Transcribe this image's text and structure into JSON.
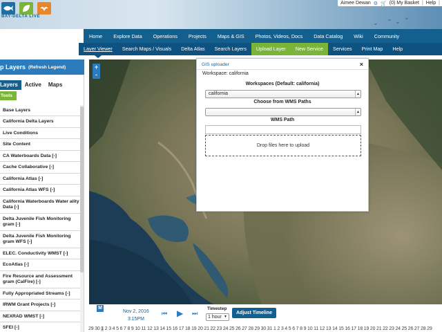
{
  "header": {
    "logo_text": "BAY-DELTA LIVE",
    "user_name": "Aimee Dewan",
    "basket": "(0) My Basket",
    "help": "Help"
  },
  "main_nav": [
    {
      "label": "Home"
    },
    {
      "label": "Explore Data"
    },
    {
      "label": "Operations"
    },
    {
      "label": "Projects"
    },
    {
      "label": "Maps & GIS"
    },
    {
      "label": "Photos, Videos, Docs"
    },
    {
      "label": "Data Catalog"
    },
    {
      "label": "Wiki"
    },
    {
      "label": "Community"
    }
  ],
  "sub_nav": [
    {
      "label": "Layer Viewer"
    },
    {
      "label": "Search Maps / Visuals"
    },
    {
      "label": "Delta Atlas"
    },
    {
      "label": "Search Layers"
    },
    {
      "label": "Upload Layer"
    },
    {
      "label": "New Service"
    },
    {
      "label": "Services"
    },
    {
      "label": "Print Map"
    },
    {
      "label": "Help"
    }
  ],
  "panel": {
    "title": "p Layers",
    "refresh": "(Refresh Legend)",
    "tabs": [
      "Layers",
      "Active",
      "Maps"
    ],
    "tools": "Tools",
    "layers": [
      "Base Layers",
      "California Delta Layers",
      "Live Conditions",
      "Site Content",
      "CA Waterboards Data [-]",
      "Cache Collaborative [-]",
      "California Atlas [-]",
      "California Atlas WFS [-]",
      "California Waterboards Water ality Data [-]",
      "Delta Juvenile Fish Monitoring gram [-]",
      "Delta Juvenile Fish Monitoring gram WFS [-]",
      "ELEC. Conductivity WMST [-]",
      "EcoAtlas [-]",
      "Fire Resource and Assessment gram (CalFire) [-]",
      "Fully Appropriated Streams [-]",
      "IRWM Grant Projects [-]",
      "NEXRAD WMST [-]",
      "SFEI [-]",
      "SFEI WFS [-]"
    ]
  },
  "map": {
    "zoom_in": "+",
    "zoom_out": "-"
  },
  "dialog": {
    "title": "GIS uploader",
    "close": "×",
    "workspace_line": "Workspace: california",
    "workspaces_label": "Workspaces (Default: california)",
    "workspace_value": "california",
    "wms_paths_label": "Choose from WMS Paths",
    "wms_paths_value": "",
    "wms_path_label": "WMS Path",
    "wms_path_value": "",
    "drop_text": "Drop files here to upload"
  },
  "timeline": {
    "m_label": "M",
    "date": "Nov 2, 2016",
    "time": "3:15PM",
    "timestep_label": "Timestep",
    "timestep_value": "1 hour",
    "adjust_label": "Adjust Timeline",
    "days": [
      "29",
      "30",
      "1",
      "2",
      "3",
      "4",
      "5",
      "6",
      "7",
      "8",
      "9",
      "10",
      "11",
      "12",
      "13",
      "14",
      "15",
      "16",
      "17",
      "18",
      "19",
      "20",
      "21",
      "22",
      "23",
      "24",
      "25",
      "26",
      "27",
      "28",
      "29",
      "30",
      "31",
      "1",
      "2",
      "3",
      "4",
      "5",
      "6",
      "7",
      "8",
      "9",
      "10",
      "11",
      "12",
      "13",
      "14",
      "15",
      "16",
      "17",
      "18",
      "19",
      "20",
      "21",
      "22",
      "23",
      "24",
      "25",
      "26",
      "27",
      "28",
      "29"
    ],
    "selected_days": [
      2
    ]
  },
  "colors": {
    "nav_blue": "#13608e",
    "accent_green": "#7ab53a",
    "panel_blue": "#2b7bbd"
  }
}
